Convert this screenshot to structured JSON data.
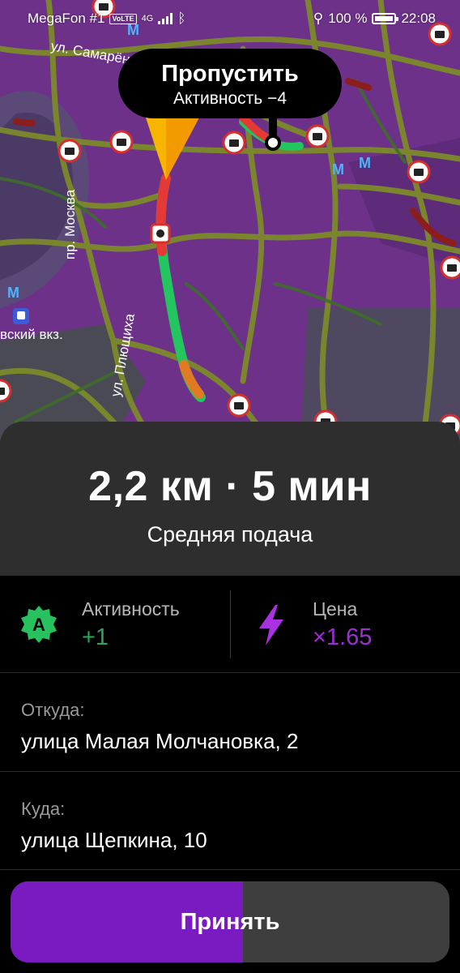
{
  "status_bar": {
    "carrier": "MegaFon #1",
    "volte": "VoLTE",
    "network": "4G",
    "battery": "100 %",
    "time": "22:08"
  },
  "map": {
    "street_labels": [
      "ул. Самарёнова",
      "пр. Москва",
      "ул. Плющиха"
    ],
    "station_label": "вский вкз.",
    "metro_letter": "М"
  },
  "skip_bubble": {
    "title": "Пропустить",
    "subtitle": "Активность −4"
  },
  "order": {
    "distance_time": "2,2 км · 5 мин",
    "feed_type": "Средняя подача"
  },
  "stats": {
    "activity": {
      "badge": "A",
      "label": "Активность",
      "value": "+1"
    },
    "price": {
      "label": "Цена",
      "value": "×1.65"
    }
  },
  "addresses": {
    "from": {
      "label": "Откуда:",
      "value": "улица Малая Молчановка, 2"
    },
    "to": {
      "label": "Куда:",
      "value": "улица Щепкина, 10"
    }
  },
  "accept_button": {
    "label": "Принять",
    "progress": 0.53
  },
  "colors": {
    "accent_purple": "#7a1bc1",
    "activity_green": "#27a85a",
    "price_purple": "#9b2fd1",
    "route_green": "#22c55e",
    "route_red": "#e53935",
    "marker_yellow": "#f7b500"
  }
}
